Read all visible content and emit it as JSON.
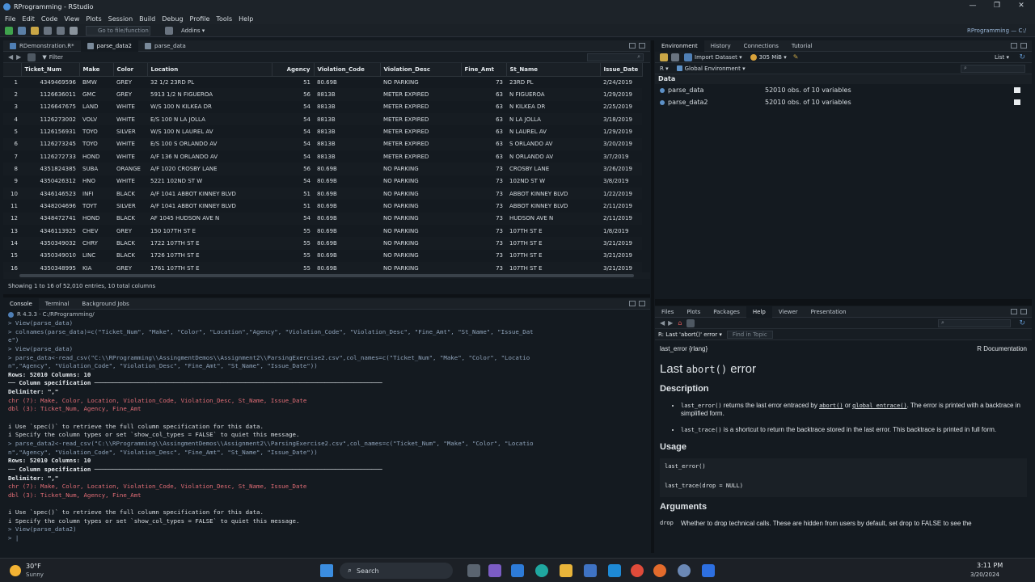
{
  "window": {
    "title": "RProgramming - RStudio",
    "minimize": "—",
    "maximize": "❐",
    "close": "✕"
  },
  "menu": [
    "File",
    "Edit",
    "Code",
    "View",
    "Plots",
    "Session",
    "Build",
    "Debug",
    "Profile",
    "Tools",
    "Help"
  ],
  "toolbar": {
    "goto_placeholder": "Go to file/function",
    "addins": "Addins ▾",
    "project": "RProgramming — C:/"
  },
  "editor": {
    "tabs": [
      "RDemonstration.R*",
      "parse_data2",
      "parse_data"
    ],
    "filter": "Filter",
    "columns": [
      "Ticket_Num",
      "Make",
      "Color",
      "Location",
      "Agency",
      "Violation_Code",
      "Violation_Desc",
      "Fine_Amt",
      "St_Name",
      "Issue_Date"
    ],
    "rows": [
      [
        "1",
        "4349469596",
        "BMW",
        "GREY",
        "32 1/2 23RD PL",
        "51",
        "80.69B",
        "NO PARKING",
        "73",
        "23RD PL",
        "2/24/2019"
      ],
      [
        "2",
        "1126636011",
        "GMC",
        "GREY",
        "5913 1/2 N FIGUEROA",
        "56",
        "8813B",
        "METER EXPIRED",
        "63",
        "N FIGUEROA",
        "1/29/2019"
      ],
      [
        "3",
        "1126647675",
        "LAND",
        "WHITE",
        "W/S 100 N KILKEA DR",
        "54",
        "8813B",
        "METER EXPIRED",
        "63",
        "N KILKEA DR",
        "2/25/2019"
      ],
      [
        "4",
        "1126273002",
        "VOLV",
        "WHITE",
        "E/S 100 N LA JOLLA",
        "54",
        "8813B",
        "METER EXPIRED",
        "63",
        "N LA JOLLA",
        "3/18/2019"
      ],
      [
        "5",
        "1126156931",
        "TOYO",
        "SILVER",
        "W/S 100 N LAUREL AV",
        "54",
        "8813B",
        "METER EXPIRED",
        "63",
        "N LAUREL AV",
        "1/29/2019"
      ],
      [
        "6",
        "1126273245",
        "TOYO",
        "WHITE",
        "E/S 100 S ORLANDO AV",
        "54",
        "8813B",
        "METER EXPIRED",
        "63",
        "S ORLANDO AV",
        "3/20/2019"
      ],
      [
        "7",
        "1126272733",
        "HOND",
        "WHITE",
        "A/F 136 N ORLANDO AV",
        "54",
        "8813B",
        "METER EXPIRED",
        "63",
        "N ORLANDO AV",
        "3/7/2019"
      ],
      [
        "8",
        "4351824385",
        "SUBA",
        "ORANGE",
        "A/F 1020 CROSBY LANE",
        "56",
        "80.69B",
        "NO PARKING",
        "73",
        "CROSBY LANE",
        "3/26/2019"
      ],
      [
        "9",
        "4350426312",
        "HNO",
        "WHITE",
        "5221 102ND ST W",
        "54",
        "80.69B",
        "NO PARKING",
        "73",
        "102ND ST W",
        "3/8/2019"
      ],
      [
        "10",
        "4346146523",
        "INFI",
        "BLACK",
        "A/F 1041 ABBOT KINNEY BLVD",
        "51",
        "80.69B",
        "NO PARKING",
        "73",
        "ABBOT KINNEY BLVD",
        "1/22/2019"
      ],
      [
        "11",
        "4348204696",
        "TOYT",
        "SILVER",
        "A/F 1041 ABBOT KINNEY BLVD",
        "51",
        "80.69B",
        "NO PARKING",
        "73",
        "ABBOT KINNEY BLVD",
        "2/11/2019"
      ],
      [
        "12",
        "4348472741",
        "HOND",
        "BLACK",
        "AF 1045 HUDSON AVE N",
        "54",
        "80.69B",
        "NO PARKING",
        "73",
        "HUDSON AVE N",
        "2/11/2019"
      ],
      [
        "13",
        "4346113925",
        "CHEV",
        "GREY",
        "150 107TH ST E",
        "55",
        "80.69B",
        "NO PARKING",
        "73",
        "107TH ST E",
        "1/8/2019"
      ],
      [
        "14",
        "4350349032",
        "CHRY",
        "BLACK",
        "1722 107TH ST E",
        "55",
        "80.69B",
        "NO PARKING",
        "73",
        "107TH ST E",
        "3/21/2019"
      ],
      [
        "15",
        "4350349010",
        "LINC",
        "BLACK",
        "1726 107TH ST E",
        "55",
        "80.69B",
        "NO PARKING",
        "73",
        "107TH ST E",
        "3/21/2019"
      ],
      [
        "16",
        "4350348995",
        "KIA",
        "GREY",
        "1761 107TH ST E",
        "55",
        "80.69B",
        "NO PARKING",
        "73",
        "107TH ST E",
        "3/21/2019"
      ]
    ],
    "status": "Showing 1 to 16 of 52,010 entries, 10 total columns"
  },
  "console": {
    "tabs": [
      "Console",
      "Terminal",
      "Background Jobs"
    ],
    "path": "R 4.3.3 · C:/RProgramming/",
    "lines": [
      {
        "c": "cmd",
        "t": "> View(parse_data)"
      },
      {
        "c": "cmd",
        "t": "> colnames(parse_data)=c(\"Ticket_Num\", \"Make\", \"Color\", \"Location\",\"Agency\", \"Violation_Code\", \"Violation_Desc\", \"Fine_Amt\", \"St_Name\", \"Issue_Dat"
      },
      {
        "c": "cmd",
        "t": "e\")"
      },
      {
        "c": "cmd",
        "t": "> View(parse_data)"
      },
      {
        "c": "cmd",
        "t": "> parse_data<-read_csv(\"C:\\\\RProgramming\\\\AssingmentDemos\\\\Assignment2\\\\ParsingExercise2.csv\",col_names=c(\"Ticket_Num\", \"Make\", \"Color\", \"Locatio"
      },
      {
        "c": "cmd",
        "t": "n\",\"Agency\", \"Violation_Code\", \"Violation_Desc\", \"Fine_Amt\", \"St_Name\", \"Issue_Date\"))"
      },
      {
        "c": "bold",
        "t": "Rows: 52010 Columns: 10"
      },
      {
        "c": "bold",
        "t": "── Column specification ────────────────────────────────────────────────────────────────────────────────"
      },
      {
        "c": "bold",
        "t": "Delimiter: \",\""
      },
      {
        "c": "chr",
        "t": "chr (7): Make, Color, Location, Violation_Code, Violation_Desc, St_Name, Issue_Date"
      },
      {
        "c": "dbl",
        "t": "dbl (3): Ticket_Num, Agency, Fine_Amt"
      },
      {
        "c": "out",
        "t": ""
      },
      {
        "c": "out",
        "t": "i Use `spec()` to retrieve the full column specification for this data."
      },
      {
        "c": "out",
        "t": "i Specify the column types or set `show_col_types = FALSE` to quiet this message."
      },
      {
        "c": "cmd",
        "t": "> parse_data2<-read_csv(\"C:\\\\RProgramming\\\\AssingmentDemos\\\\Assignment2\\\\ParsingExercise2.csv\",col_names=c(\"Ticket_Num\", \"Make\", \"Color\", \"Locatio"
      },
      {
        "c": "cmd",
        "t": "n\",\"Agency\", \"Violation_Code\", \"Violation_Desc\", \"Fine_Amt\", \"St_Name\", \"Issue_Date\"))"
      },
      {
        "c": "bold",
        "t": "Rows: 52010 Columns: 10"
      },
      {
        "c": "bold",
        "t": "── Column specification ────────────────────────────────────────────────────────────────────────────────"
      },
      {
        "c": "bold",
        "t": "Delimiter: \",\""
      },
      {
        "c": "chr",
        "t": "chr (7): Make, Color, Location, Violation_Code, Violation_Desc, St_Name, Issue_Date"
      },
      {
        "c": "dbl",
        "t": "dbl (3): Ticket_Num, Agency, Fine_Amt"
      },
      {
        "c": "out",
        "t": ""
      },
      {
        "c": "out",
        "t": "i Use `spec()` to retrieve the full column specification for this data."
      },
      {
        "c": "out",
        "t": "i Specify the column types or set `show_col_types = FALSE` to quiet this message."
      },
      {
        "c": "cmd",
        "t": "> View(parse_data2)"
      },
      {
        "c": "cmd",
        "t": "> |"
      }
    ]
  },
  "environment": {
    "tabs": [
      "Environment",
      "History",
      "Connections",
      "Tutorial"
    ],
    "import": "Import Dataset ▾",
    "memory": "305 MiB ▾",
    "list": "List ▾",
    "lang": "R ▾",
    "scope": "Global Environment ▾",
    "section": "Data",
    "items": [
      {
        "name": "parse_data",
        "desc": "52010 obs. of 10 variables"
      },
      {
        "name": "parse_data2",
        "desc": "52010 obs. of 10 variables"
      }
    ]
  },
  "help": {
    "tabs": [
      "Files",
      "Plots",
      "Packages",
      "Help",
      "Viewer",
      "Presentation"
    ],
    "topic": "R: Last 'abort()' error ▾",
    "find": "Find in Topic",
    "header_left": "last_error {rlang}",
    "header_right": "R Documentation",
    "title_a": "Last ",
    "title_code": "abort()",
    "title_b": " error",
    "desc_h": "Description",
    "b1_code": "last_error()",
    "b1_a": " returns the last error entraced by ",
    "b1_c2": "abort()",
    "b1_or": " or ",
    "b1_c3": "global_entrace()",
    "b1_b": ". The error is printed with a backtrace in simplified form.",
    "b2_code": "last_trace()",
    "b2_a": " is a shortcut to return the backtrace stored in the last error. This backtrace is printed in full form.",
    "usage_h": "Usage",
    "u1": "last_error()",
    "u2": "last_trace(drop = NULL)",
    "args_h": "Arguments",
    "arg_name": "drop",
    "arg_desc": "Whether to drop technical calls. These are hidden from users by default, set drop to FALSE to see the"
  },
  "taskbar": {
    "temp": "30°F",
    "weather": "Sunny",
    "search": "Search",
    "time": "3:11 PM",
    "date": "3/20/2024"
  }
}
